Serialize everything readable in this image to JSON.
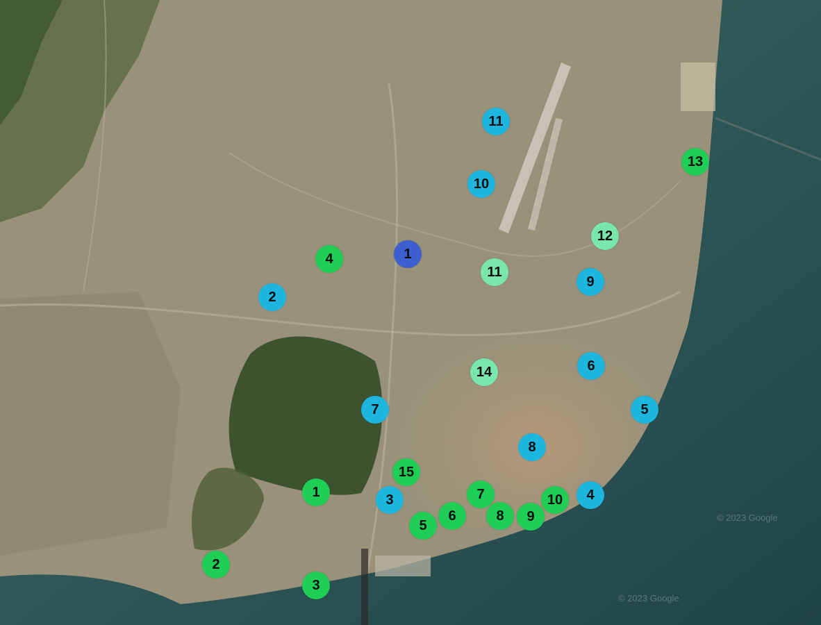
{
  "map": {
    "attribution": "© 2023 Google",
    "markers": [
      {
        "label": "1",
        "color": "#3d5fcf",
        "group": "navy"
      },
      {
        "label": "4",
        "color": "#1fcf55",
        "group": "green"
      },
      {
        "label": "2",
        "color": "#1db6de",
        "group": "cyan"
      },
      {
        "label": "11",
        "color": "#1db6de",
        "group": "cyan"
      },
      {
        "label": "10",
        "color": "#1db6de",
        "group": "cyan"
      },
      {
        "label": "13",
        "color": "#1fcf55",
        "group": "green"
      },
      {
        "label": "12",
        "color": "#78e6ad",
        "group": "mint"
      },
      {
        "label": "11",
        "color": "#78e6ad",
        "group": "mint"
      },
      {
        "label": "9",
        "color": "#1db6de",
        "group": "cyan"
      },
      {
        "label": "6",
        "color": "#1db6de",
        "group": "cyan"
      },
      {
        "label": "14",
        "color": "#78e6ad",
        "group": "mint"
      },
      {
        "label": "5",
        "color": "#1db6de",
        "group": "cyan"
      },
      {
        "label": "7",
        "color": "#1db6de",
        "group": "cyan"
      },
      {
        "label": "8",
        "color": "#1db6de",
        "group": "cyan"
      },
      {
        "label": "15",
        "color": "#1fcf55",
        "group": "green"
      },
      {
        "label": "1",
        "color": "#1fcf55",
        "group": "green"
      },
      {
        "label": "3",
        "color": "#1db6de",
        "group": "cyan"
      },
      {
        "label": "7",
        "color": "#1fcf55",
        "group": "green"
      },
      {
        "label": "10",
        "color": "#1fcf55",
        "group": "green"
      },
      {
        "label": "4",
        "color": "#1db6de",
        "group": "cyan"
      },
      {
        "label": "6",
        "color": "#1fcf55",
        "group": "green"
      },
      {
        "label": "8",
        "color": "#1fcf55",
        "group": "green"
      },
      {
        "label": "9",
        "color": "#1fcf55",
        "group": "green"
      },
      {
        "label": "5",
        "color": "#1fcf55",
        "group": "green"
      },
      {
        "label": "2",
        "color": "#1fcf55",
        "group": "green"
      },
      {
        "label": "3",
        "color": "#1fcf55",
        "group": "green"
      }
    ]
  }
}
